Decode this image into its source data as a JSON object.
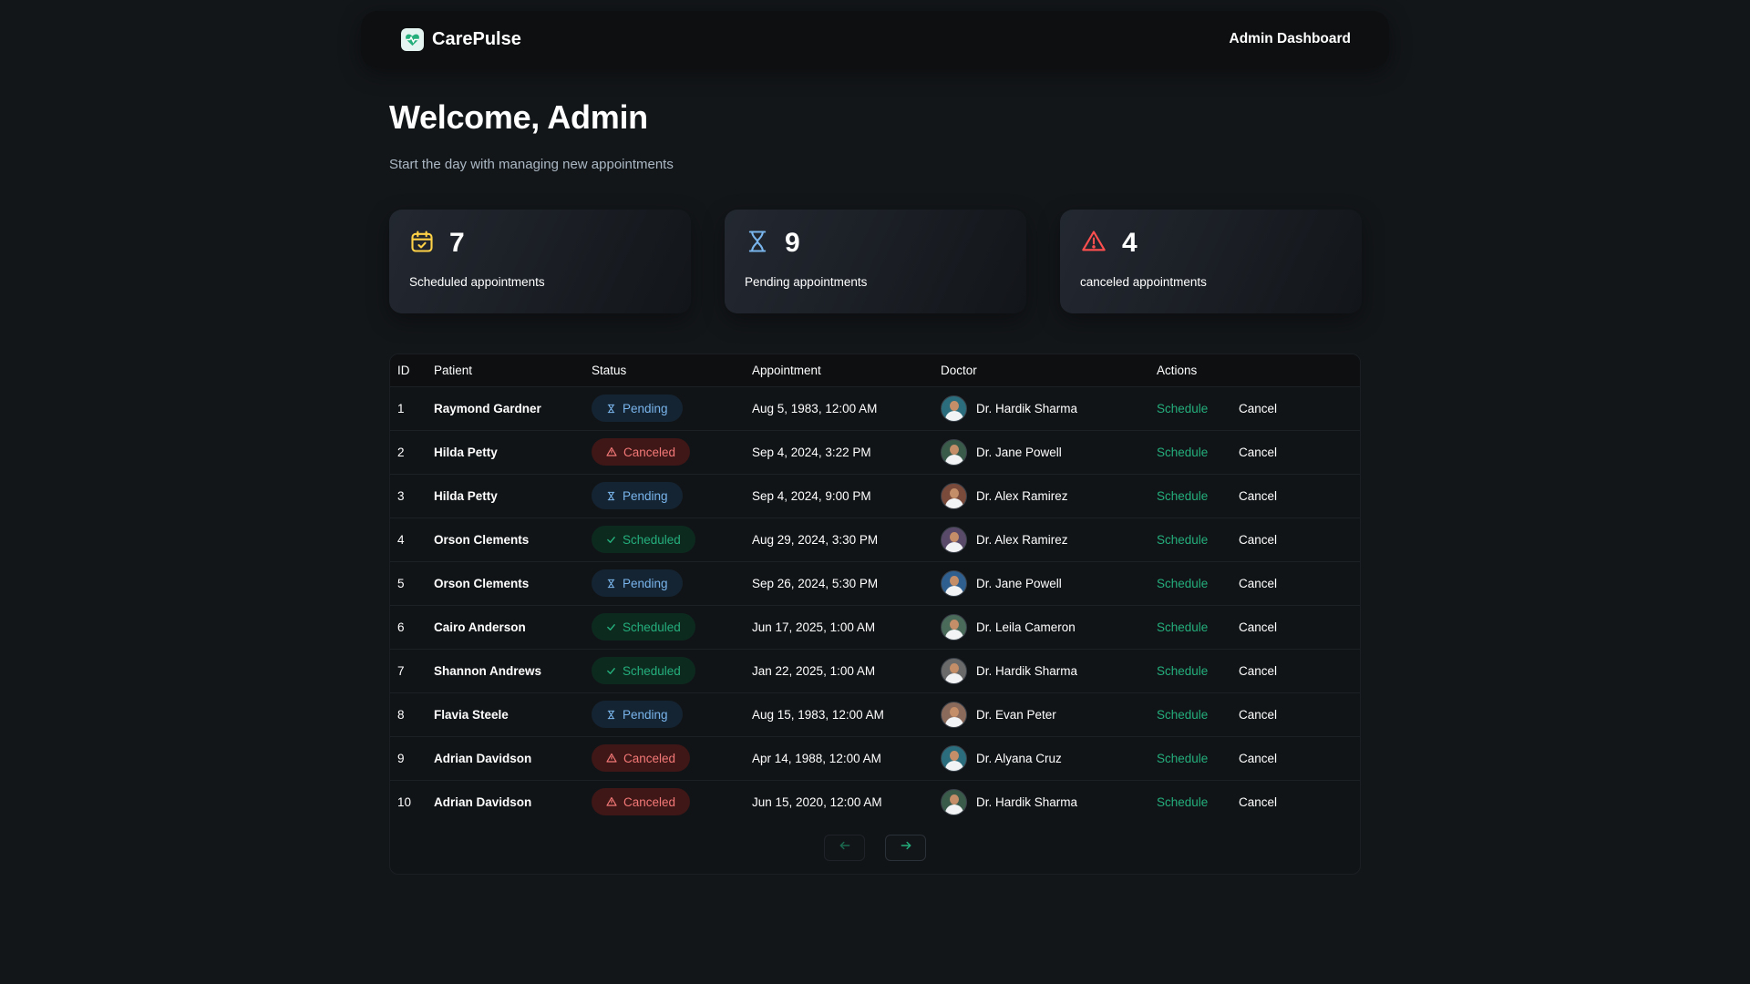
{
  "header": {
    "brand": "CarePulse",
    "title": "Admin Dashboard"
  },
  "welcome": {
    "heading": "Welcome, Admin",
    "subtitle": "Start the day with managing new appointments"
  },
  "stats": [
    {
      "count": "7",
      "label": "Scheduled appointments",
      "icon": "calendar-check-icon",
      "color": "#ffd147"
    },
    {
      "count": "9",
      "label": "Pending appointments",
      "icon": "hourglass-icon",
      "color": "#79b5ec"
    },
    {
      "count": "4",
      "label": "canceled appointments",
      "icon": "alert-triangle-icon",
      "color": "#ff4f4e"
    }
  ],
  "table": {
    "columns": [
      "ID",
      "Patient",
      "Status",
      "Appointment",
      "Doctor",
      "Actions"
    ],
    "rows": [
      {
        "id": "1",
        "patient": "Raymond Gardner",
        "status": "Pending",
        "appointment": "Aug 5, 1983, 12:00 AM",
        "doctor": "Dr. Hardik Sharma",
        "schedule": "Schedule",
        "cancel": "Cancel"
      },
      {
        "id": "2",
        "patient": "Hilda Petty",
        "status": "Canceled",
        "appointment": "Sep 4, 2024, 3:22 PM",
        "doctor": "Dr. Jane Powell",
        "schedule": "Schedule",
        "cancel": "Cancel"
      },
      {
        "id": "3",
        "patient": "Hilda Petty",
        "status": "Pending",
        "appointment": "Sep 4, 2024, 9:00 PM",
        "doctor": "Dr. Alex Ramirez",
        "schedule": "Schedule",
        "cancel": "Cancel"
      },
      {
        "id": "4",
        "patient": "Orson Clements",
        "status": "Scheduled",
        "appointment": "Aug 29, 2024, 3:30 PM",
        "doctor": "Dr. Alex Ramirez",
        "schedule": "Schedule",
        "cancel": "Cancel"
      },
      {
        "id": "5",
        "patient": "Orson Clements",
        "status": "Pending",
        "appointment": "Sep 26, 2024, 5:30 PM",
        "doctor": "Dr. Jane Powell",
        "schedule": "Schedule",
        "cancel": "Cancel"
      },
      {
        "id": "6",
        "patient": "Cairo Anderson",
        "status": "Scheduled",
        "appointment": "Jun 17, 2025, 1:00 AM",
        "doctor": "Dr. Leila Cameron",
        "schedule": "Schedule",
        "cancel": "Cancel"
      },
      {
        "id": "7",
        "patient": "Shannon Andrews",
        "status": "Scheduled",
        "appointment": "Jan 22, 2025, 1:00 AM",
        "doctor": "Dr. Hardik Sharma",
        "schedule": "Schedule",
        "cancel": "Cancel"
      },
      {
        "id": "8",
        "patient": "Flavia Steele",
        "status": "Pending",
        "appointment": "Aug 15, 1983, 12:00 AM",
        "doctor": "Dr. Evan Peter",
        "schedule": "Schedule",
        "cancel": "Cancel"
      },
      {
        "id": "9",
        "patient": "Adrian Davidson",
        "status": "Canceled",
        "appointment": "Apr 14, 1988, 12:00 AM",
        "doctor": "Dr. Alyana Cruz",
        "schedule": "Schedule",
        "cancel": "Cancel"
      },
      {
        "id": "10",
        "patient": "Adrian Davidson",
        "status": "Canceled",
        "appointment": "Jun 15, 2020, 12:00 AM",
        "doctor": "Dr. Hardik Sharma",
        "schedule": "Schedule",
        "cancel": "Cancel"
      }
    ]
  },
  "pagination": {
    "prev_icon": "arrow-left-icon",
    "next_icon": "arrow-right-icon"
  },
  "colors": {
    "pending": "#79b5ec",
    "canceled": "#f37877",
    "scheduled": "#24ae7c",
    "background": "#131619"
  }
}
